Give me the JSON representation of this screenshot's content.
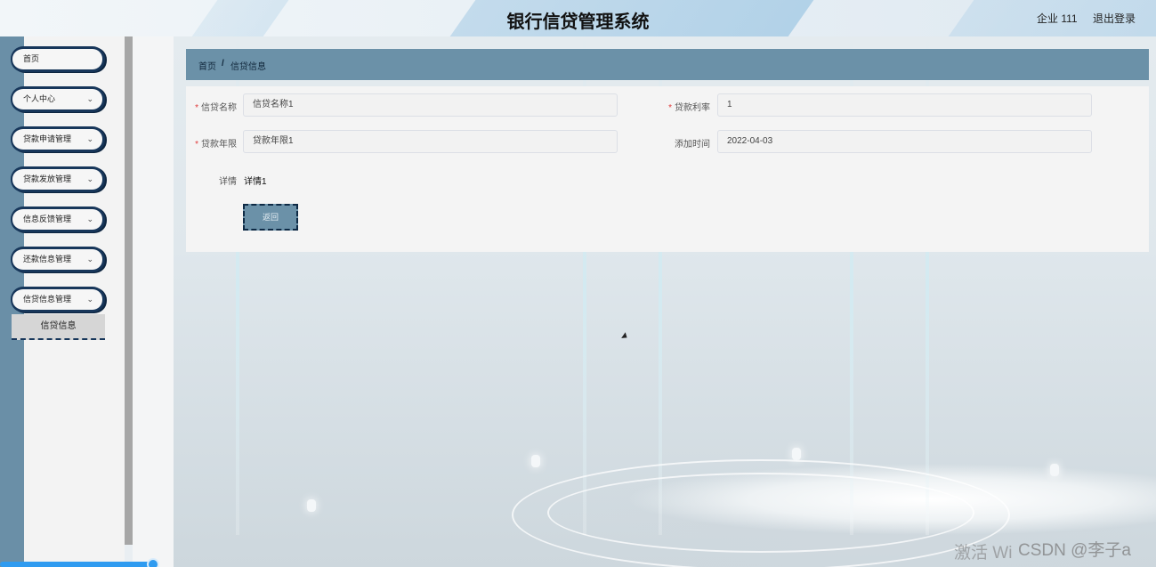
{
  "header": {
    "title": "银行信贷管理系统",
    "user": "企业 111",
    "logout": "退出登录"
  },
  "sidebar": {
    "items": [
      {
        "label": "首页",
        "has_chevron": false
      },
      {
        "label": "个人中心",
        "has_chevron": true
      },
      {
        "label": "贷款申请管理",
        "has_chevron": true
      },
      {
        "label": "贷款发放管理",
        "has_chevron": true
      },
      {
        "label": "信息反馈管理",
        "has_chevron": true
      },
      {
        "label": "还款信息管理",
        "has_chevron": true
      },
      {
        "label": "信贷信息管理",
        "has_chevron": true
      }
    ],
    "chevron": "⌄",
    "sub_item": "信贷信息"
  },
  "breadcrumb": {
    "home": "首页",
    "separator": "/",
    "current": "信贷信息"
  },
  "form": {
    "name_label": "信贷名称",
    "name_value": "信贷名称1",
    "rate_label": "贷款利率",
    "rate_value": "1",
    "term_label": "贷款年限",
    "term_value": "贷款年限1",
    "time_label": "添加时间",
    "time_value": "2022-04-03",
    "detail_label": "详情",
    "detail_value": "详情1",
    "required_mark": "*",
    "back_button": "返回"
  },
  "watermark": {
    "activate": "激活 Wi",
    "csdn": "CSDN @李子a"
  },
  "colors": {
    "sidebar_strip": "#6a8fa7",
    "breadcrumb_bar": "#6b91a8",
    "menu_border": "#17365a",
    "required": "#e03b3b"
  }
}
